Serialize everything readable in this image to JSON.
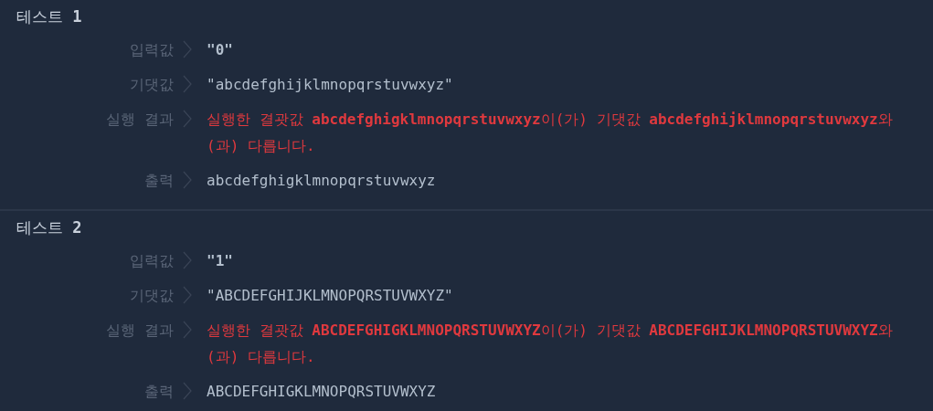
{
  "tests": [
    {
      "title": "테스트 **1**",
      "rows": [
        {
          "kind": "input",
          "label": "입력값",
          "value": "\"0\""
        },
        {
          "kind": "expected",
          "label": "기댓값",
          "value": "\"abcdefghijklmnopqrstuvwxyz\""
        },
        {
          "kind": "result",
          "label": "실행 결과",
          "value": "실행한 결괏값 **abcdefghigklmnopqrstuvwxyz**이(가) 기댓값 **abcdefghijklmnopqrstuvwxyz**와(과) 다릅니다."
        },
        {
          "kind": "output",
          "label": "출력",
          "value": "abcdefghigklmnopqrstuvwxyz"
        }
      ]
    },
    {
      "title": "테스트 **2**",
      "rows": [
        {
          "kind": "input",
          "label": "입력값",
          "value": "\"1\""
        },
        {
          "kind": "expected",
          "label": "기댓값",
          "value": "\"ABCDEFGHIJKLMNOPQRSTUVWXYZ\""
        },
        {
          "kind": "result",
          "label": "실행 결과",
          "value": "실행한 결괏값 **ABCDEFGHIGKLMNOPQRSTUVWXYZ**이(가) 기댓값 **ABCDEFGHIJKLMNOPQRSTUVWXYZ**와(과) 다릅니다."
        },
        {
          "kind": "output",
          "label": "출력",
          "value": "ABCDEFGHIGKLMNOPQRSTUVWXYZ"
        }
      ]
    }
  ]
}
